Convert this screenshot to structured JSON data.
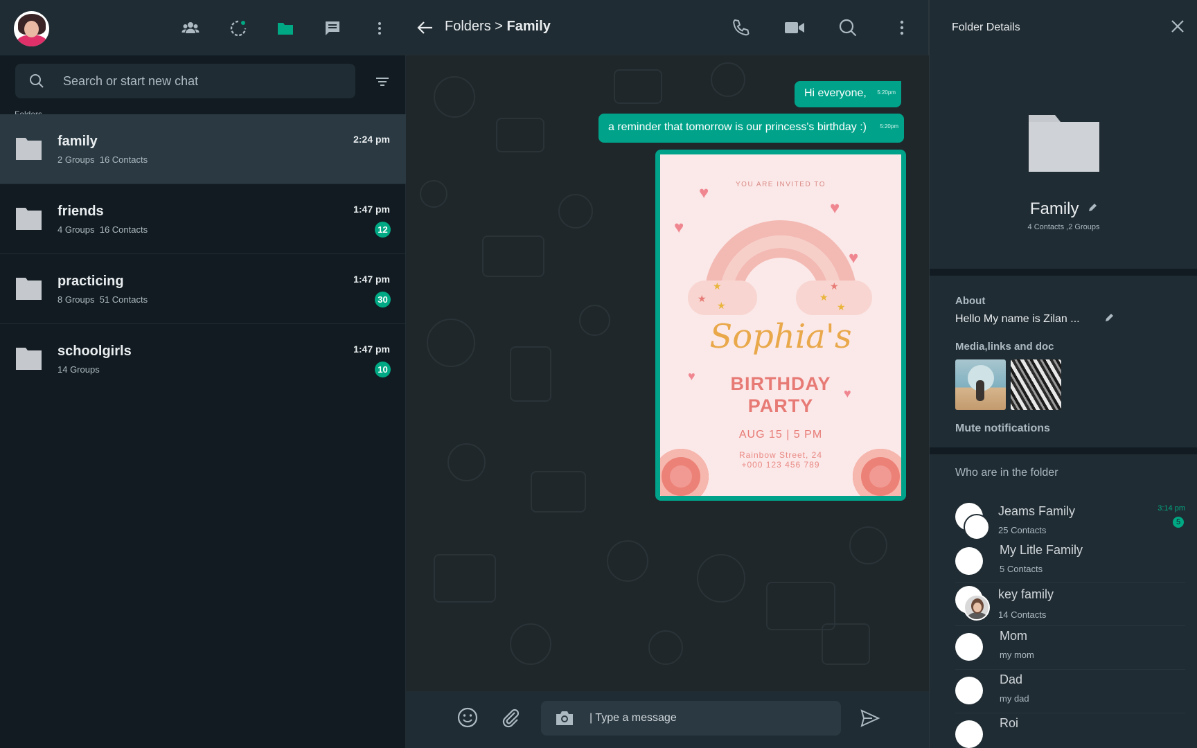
{
  "left": {
    "search_placeholder": "Search or start new chat",
    "folders_label": "Folders",
    "folders": [
      {
        "name": "family",
        "groups": "2 Groups",
        "contacts": "16 Contacts",
        "time": "2:24 pm",
        "badge": ""
      },
      {
        "name": "friends",
        "groups": "4 Groups",
        "contacts": "16 Contacts",
        "time": "1:47 pm",
        "badge": "12"
      },
      {
        "name": "practicing",
        "groups": "8 Groups",
        "contacts": "51 Contacts",
        "time": "1:47 pm",
        "badge": "30"
      },
      {
        "name": "schoolgirls",
        "groups": "14 Groups",
        "contacts": "",
        "time": "1:47 pm",
        "badge": "10"
      }
    ]
  },
  "chat": {
    "title_prefix": "Folders > ",
    "title_name": "Family",
    "messages": [
      {
        "text": "Hi everyone,",
        "time": "5:20pm"
      },
      {
        "text": "a reminder that tomorrow is our princess's birthday :)",
        "time": "5:20pm"
      }
    ],
    "invite": {
      "top": "YOU ARE INVITED TO",
      "name": "Sophia's",
      "line1": "BIRTHDAY",
      "line2": "PARTY",
      "date": "AUG 15 | 5 PM",
      "addr1": "Rainbow Street, 24",
      "addr2": "+000 123 456 789"
    },
    "compose_placeholder": "| Type a message"
  },
  "details": {
    "title": "Folder Details",
    "folder_name": "Family",
    "folder_sub": "4 Contacts ,2 Groups",
    "about_label": "About",
    "about_value": "Hello My name is Zilan ...",
    "media_label": "Media,links and doc",
    "mute_label": "Mute notifications",
    "who_label": "Who are in the folder",
    "members": [
      {
        "name": "Jeams Family",
        "sub": "25 Contacts",
        "time": "3:14 pm",
        "badge": "5"
      },
      {
        "name": "My Litle Family",
        "sub": "5 Contacts"
      },
      {
        "name": "key family",
        "sub": "14 Contacts"
      },
      {
        "name": "Mom",
        "sub": "my mom"
      },
      {
        "name": "Dad",
        "sub": "my dad"
      },
      {
        "name": "Roi",
        "sub": ""
      }
    ]
  },
  "colors": {
    "accent": "#00a884",
    "panel": "#202c33",
    "background": "#111b21"
  }
}
